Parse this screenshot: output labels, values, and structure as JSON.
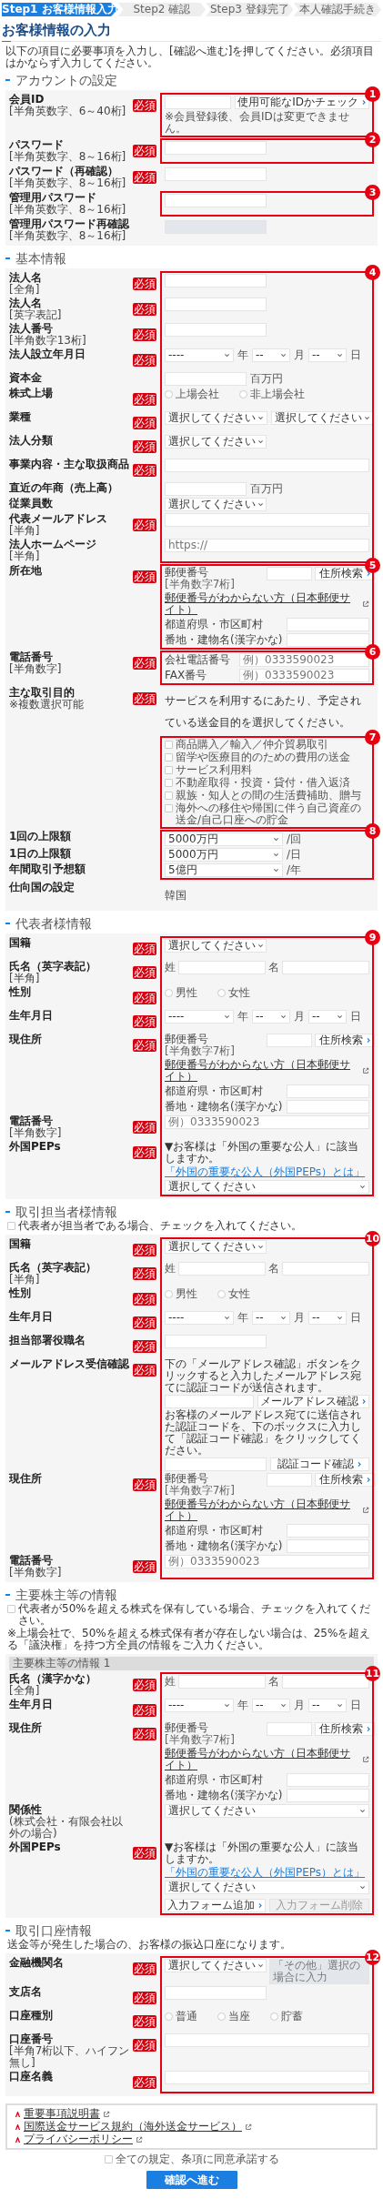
{
  "steps": [
    {
      "label": "Step1 お客様情報入力",
      "selected": true
    },
    {
      "label": "Step2 確認",
      "selected": false
    },
    {
      "label": "Step3 登録完了",
      "selected": false
    },
    {
      "label": "本人確認手続き",
      "selected": false
    }
  ],
  "title": "お客様情報の入力",
  "intro": "以下の項目に必要事項を入力し、[確認へ進む]を押してください。必須項目はかならず入力してください。",
  "sections": [
    {
      "title": "アカウントの設定",
      "blocks": [
        {
          "annotation": "1",
          "rows": [
            {
              "label": "会員ID",
              "hint": "[半角英数字、6～40桁]",
              "badge": "必須",
              "kind": "id_check",
              "button": "使用可能なIDかチェック",
              "note": "※会員登録後、会員IDは変更できません。"
            }
          ]
        },
        {
          "annotation": "2",
          "rows": [
            {
              "label": "パスワード",
              "hint": "[半角英数字、8～16桁]",
              "badge": "必須",
              "kind": "text"
            }
          ]
        },
        {
          "rows": [
            {
              "label": "パスワード（再確認）",
              "hint": "[半角英数字、8～16桁]",
              "badge": "必須",
              "kind": "text"
            }
          ]
        },
        {
          "annotation": "3",
          "rows": [
            {
              "label": "管理用パスワード",
              "hint": "[半角英数字、8～16桁]",
              "kind": "text"
            }
          ]
        },
        {
          "rows": [
            {
              "label": "管理用パスワード再確認",
              "hint": "[半角英数字、8～16桁]",
              "kind": "text",
              "disabled": true
            }
          ]
        }
      ]
    },
    {
      "title": "基本情報",
      "blocks": [
        {
          "annotation": "4",
          "rows": [
            {
              "label": "法人名",
              "hint": "[全角]",
              "badge": "必須",
              "kind": "text"
            },
            {
              "label": "法人名",
              "hint": "[英字表記]",
              "badge": "必須",
              "kind": "text"
            },
            {
              "label": "法人番号",
              "hint": "[半角数字13桁]",
              "badge": "必須",
              "kind": "text"
            },
            {
              "label": "法人設立年月日",
              "badge": "必須",
              "kind": "date",
              "year": "----",
              "year_unit": "年",
              "month": "--",
              "month_unit": "月",
              "day": "--",
              "day_unit": "日"
            },
            {
              "label": "資本金",
              "kind": "text_unit",
              "unit": "百万円"
            },
            {
              "label": "株式上場",
              "badge": "必須",
              "kind": "radio",
              "options": [
                {
                  "label": "上場会社",
                  "selected": false
                },
                {
                  "label": "非上場会社",
                  "selected": false
                }
              ]
            },
            {
              "label": "業種",
              "badge": "必須",
              "kind": "selects",
              "selects": [
                "選択してください",
                "選択してください"
              ]
            },
            {
              "label": "法人分類",
              "badge": "必須",
              "kind": "select",
              "value": "選択してください"
            },
            {
              "label": "事業内容・主な取扱商品",
              "badge": "必須",
              "kind": "text_wide"
            },
            {
              "label": "直近の年商（売上高）",
              "kind": "text_unit",
              "unit": "百万円"
            },
            {
              "label": "従業員数",
              "kind": "select",
              "value": "選択してください"
            },
            {
              "label": "代表メールアドレス",
              "hint": "[半角]",
              "badge": "必須",
              "kind": "text_wide"
            },
            {
              "label": "法人ホームページ",
              "hint": "[半角]",
              "kind": "text_wide",
              "placeholder": "https://"
            }
          ]
        },
        {
          "annotation": "5",
          "rows": [
            {
              "label": "所在地",
              "badge": "必須",
              "kind": "address",
              "postal_label": "郵便番号",
              "postal_hint": "[半角数字7桁]",
              "search_button": "住所検索",
              "help_link": "郵便番号がわからない方（日本郵便サイト）",
              "city_label": "都道府県・市区町村",
              "street_label": "番地・建物名(漢字かな)"
            }
          ]
        },
        {
          "annotation": "6",
          "rows": [
            {
              "label": "電話番号",
              "hint": "[半角数字]",
              "badge": "必須",
              "kind": "phones",
              "items": [
                {
                  "label": "会社電話番号",
                  "placeholder": "例）0333590023"
                },
                {
                  "label": "FAX番号",
                  "placeholder": "例）0333590023"
                }
              ]
            }
          ]
        },
        {
          "rows": [
            {
              "label": "主な取引目的",
              "hint": "※複数選択可能",
              "badge": "必須",
              "kind": "note",
              "text": "サービスを利用するにあたり、予定されている送金目的を選択してください。"
            }
          ]
        },
        {
          "annotation": "7",
          "rows": [
            {
              "kind": "checkboxes",
              "options": [
                {
                  "label": "商品購入／輸入／仲介貿易取引",
                  "checked": false
                },
                {
                  "label": "留学や医療目的のための費用の送金",
                  "checked": false
                },
                {
                  "label": "サービス利用料",
                  "checked": false
                },
                {
                  "label": "不動産取得・投資・貸付・借入返済",
                  "checked": false
                },
                {
                  "label": "親族・知人との間の生活費補助、贈与",
                  "checked": false
                },
                {
                  "label": "海外への移住や帰国に伴う自己資産の送金/自己口座への貯金",
                  "checked": false
                }
              ]
            }
          ]
        },
        {
          "annotation": "8",
          "rows": [
            {
              "label": "1回の上限額",
              "kind": "select_unit",
              "value": "5000万円",
              "unit": "/回"
            },
            {
              "label": "1日の上限額",
              "kind": "select_unit",
              "value": "5000万円",
              "unit": "/日"
            },
            {
              "label": "年間取引予想額",
              "kind": "select_unit",
              "value": "5億円",
              "unit": "/年"
            }
          ]
        },
        {
          "rows": [
            {
              "label": "仕向国の設定",
              "kind": "value",
              "value": "韓国"
            }
          ]
        }
      ]
    },
    {
      "title": "代表者様情報",
      "blocks": [
        {
          "annotation": "9",
          "rows": [
            {
              "label": "国籍",
              "badge": "必須",
              "kind": "select",
              "value": "選択してください"
            },
            {
              "label": "氏名（英字表記）",
              "hint": "[半角]",
              "badge": "必須",
              "kind": "name",
              "last": "姓",
              "first": "名"
            },
            {
              "label": "性別",
              "badge": "必須",
              "kind": "radio",
              "options": [
                {
                  "label": "男性",
                  "selected": false
                },
                {
                  "label": "女性",
                  "selected": false
                }
              ]
            },
            {
              "label": "生年月日",
              "badge": "必須",
              "kind": "date",
              "year": "----",
              "year_unit": "年",
              "month": "--",
              "month_unit": "月",
              "day": "--",
              "day_unit": "日"
            },
            {
              "label": "現住所",
              "badge": "必須",
              "kind": "address",
              "postal_label": "郵便番号",
              "postal_hint": "[半角数字7桁]",
              "search_button": "住所検索",
              "help_link": "郵便番号がわからない方（日本郵便サイト）",
              "city_label": "都道府県・市区町村",
              "street_label": "番地・建物名(漢字かな)"
            },
            {
              "label": "電話番号",
              "hint": "[半角数字]",
              "badge": "必須",
              "kind": "text_wide",
              "placeholder": "例）0333590023"
            },
            {
              "label": "外国PEPs",
              "badge": "必須",
              "kind": "peps",
              "question": "▼お客様は「外国の重要な公人」に該当しますか。",
              "link": "「外国の重要な公人（外国PEPs）とは」",
              "value": "選択してください"
            }
          ]
        }
      ]
    },
    {
      "title": "取引担当者様情報",
      "notes": [
        {
          "kind": "checkbox",
          "text": "代表者が担当者である場合、チェックを入れてください。",
          "checked": false
        }
      ],
      "blocks": [
        {
          "annotation": "10",
          "rows": [
            {
              "label": "国籍",
              "badge": "必須",
              "kind": "select",
              "value": "選択してください"
            },
            {
              "label": "氏名（英字表記）",
              "hint": "[半角]",
              "badge": "必須",
              "kind": "name",
              "last": "姓",
              "first": "名"
            },
            {
              "label": "性別",
              "badge": "必須",
              "kind": "radio",
              "options": [
                {
                  "label": "男性",
                  "selected": false
                },
                {
                  "label": "女性",
                  "selected": false
                }
              ]
            },
            {
              "label": "生年月日",
              "badge": "必須",
              "kind": "date",
              "year": "----",
              "year_unit": "年",
              "month": "--",
              "month_unit": "月",
              "day": "--",
              "day_unit": "日"
            },
            {
              "label": "担当部署役職名",
              "badge": "必須",
              "kind": "text"
            },
            {
              "label": "メールアドレス受信確認",
              "badge": "必須",
              "kind": "email_verify",
              "text1": "下の「メールアドレス確認」ボタンをクリックすると入力したメールアドレス宛てに認証コードが送信されます。",
              "button1": "メールアドレス確認",
              "text2": "お客様のメールアドレス宛てに送信された認証コードを、下のボックスに入力して「認証コード確認」をクリックしてください。",
              "button2": "認証コード確認"
            },
            {
              "label": "現住所",
              "badge": "必須",
              "kind": "address",
              "postal_label": "郵便番号",
              "postal_hint": "[半角数字7桁]",
              "search_button": "住所検索",
              "help_link": "郵便番号がわからない方（日本郵便サイト）",
              "city_label": "都道府県・市区町村",
              "street_label": "番地・建物名(漢字かな)"
            },
            {
              "label": "電話番号",
              "hint": "[半角数字]",
              "badge": "必須",
              "kind": "text_wide",
              "placeholder": "例）0333590023"
            }
          ]
        }
      ]
    },
    {
      "title": "主要株主等の情報",
      "notes": [
        {
          "kind": "checkbox",
          "text": "代表者が50%を超える株式を保有している場合、チェックを入れてください。",
          "checked": false
        },
        {
          "kind": "text",
          "text": "※上場会社で、50%を超える株式保有者が存在しない場合は、25%を超える「議決権」を持つ方全員の情報をご入力ください。"
        }
      ],
      "subheader": "主要株主等の情報 1",
      "blocks": [
        {
          "annotation": "11",
          "rows": [
            {
              "label": "氏名（漢字かな）",
              "hint": "[全角]",
              "badge": "必須",
              "kind": "name",
              "last": "姓",
              "first": "名"
            },
            {
              "label": "生年月日",
              "badge": "必須",
              "kind": "date",
              "year": "----",
              "year_unit": "年",
              "month": "--",
              "month_unit": "月",
              "day": "--",
              "day_unit": "日"
            },
            {
              "label": "現住所",
              "badge": "必須",
              "kind": "address",
              "postal_label": "郵便番号",
              "postal_hint": "[半角数字7桁]",
              "search_button": "住所検索",
              "help_link": "郵便番号がわからない方（日本郵便サイト）",
              "city_label": "都道府県・市区町村",
              "street_label": "番地・建物名(漢字かな)"
            },
            {
              "label": "関係性",
              "hint": "(株式会社・有限会社以外の場合)",
              "kind": "select_wide",
              "value": "選択してください"
            },
            {
              "label": "外国PEPs",
              "badge": "必須",
              "kind": "peps",
              "question": "▼お客様は「外国の重要な公人」に該当しますか。",
              "link": "「外国の重要な公人（外国PEPs）とは」",
              "value": "選択してください"
            },
            {
              "kind": "buttons",
              "buttons": [
                {
                  "label": "入力フォーム追加",
                  "disabled": false
                },
                {
                  "label": "入力フォーム削除",
                  "disabled": true
                }
              ]
            }
          ]
        }
      ]
    },
    {
      "title": "取引口座情報",
      "notes": [
        {
          "kind": "text",
          "text": "送金等が発生した場合の、お客様の振込口座になります。"
        }
      ],
      "blocks": [
        {
          "annotation": "12",
          "rows": [
            {
              "label": "金融機関名",
              "badge": "必須",
              "kind": "select_other",
              "value": "選択してください",
              "placeholder": "「その他」選択の場合に入力"
            },
            {
              "label": "支店名",
              "badge": "必須",
              "kind": "text"
            },
            {
              "label": "口座種別",
              "badge": "必須",
              "kind": "radio",
              "options": [
                {
                  "label": "普通",
                  "selected": false
                },
                {
                  "label": "当座",
                  "selected": false
                },
                {
                  "label": "貯蓄",
                  "selected": false
                }
              ]
            },
            {
              "label": "口座番号",
              "hint": "[半角7桁以下、ハイフン無し]",
              "badge": "必須",
              "kind": "text_wide"
            },
            {
              "label": "口座名義",
              "badge": "必須",
              "kind": "text_wide"
            }
          ]
        }
      ]
    }
  ],
  "documents": [
    "重要事項説明書",
    "国際送金サービス規約（海外送金サービス）",
    "プライバシーポリシー"
  ],
  "agree": {
    "label": "全ての規定、条項に同意承諾する",
    "checked": false
  },
  "submit": "確認へ進む"
}
